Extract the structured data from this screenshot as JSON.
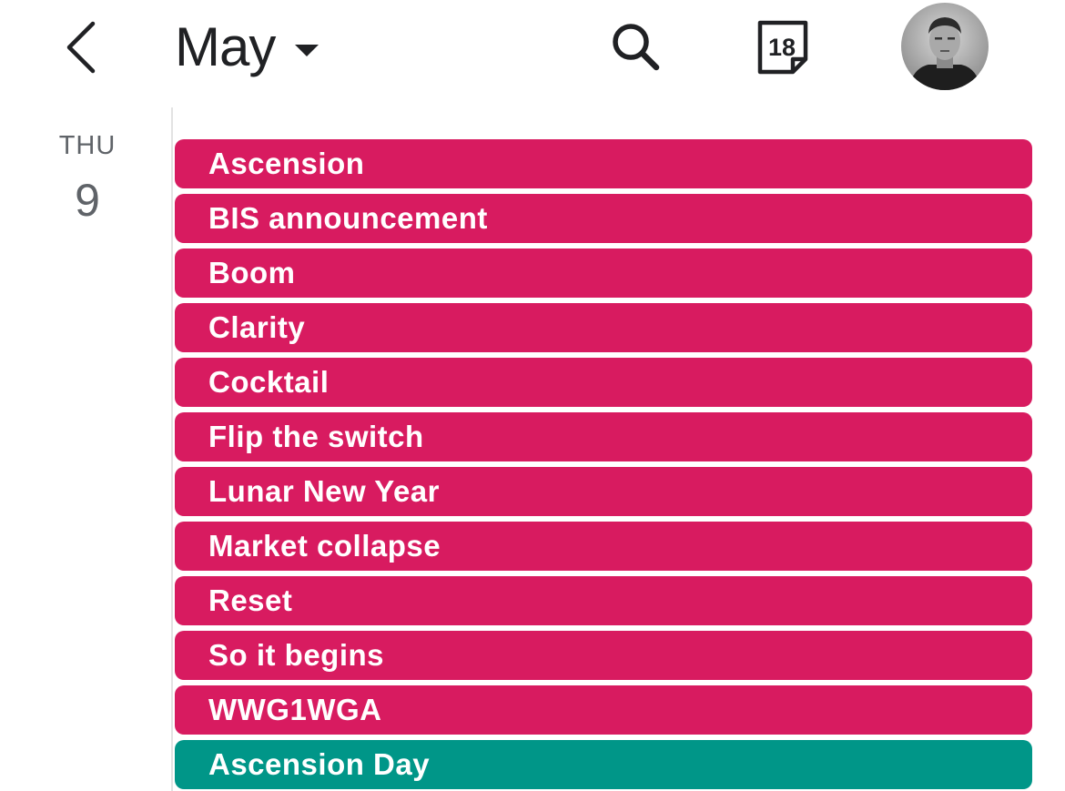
{
  "header": {
    "back_icon": "chevron-left-icon",
    "month": "May",
    "dropdown_icon": "caret-down-icon",
    "search_icon": "search-icon",
    "today_number": "18",
    "today_icon": "calendar-today-icon",
    "avatar_icon": "user-avatar"
  },
  "day": {
    "name": "THU",
    "number": "9"
  },
  "colors": {
    "event_magenta": "#D81B60",
    "event_teal": "#009688",
    "text_primary": "#202124",
    "text_secondary": "#5f6368"
  },
  "events": [
    {
      "title": "Ascension",
      "color": "#D81B60"
    },
    {
      "title": "BIS announcement",
      "color": "#D81B60"
    },
    {
      "title": "Boom",
      "color": "#D81B60"
    },
    {
      "title": "Clarity",
      "color": "#D81B60"
    },
    {
      "title": "Cocktail",
      "color": "#D81B60"
    },
    {
      "title": "Flip the switch",
      "color": "#D81B60"
    },
    {
      "title": "Lunar New Year",
      "color": "#D81B60"
    },
    {
      "title": "Market collapse",
      "color": "#D81B60"
    },
    {
      "title": "Reset",
      "color": "#D81B60"
    },
    {
      "title": "So it begins",
      "color": "#D81B60"
    },
    {
      "title": "WWG1WGA",
      "color": "#D81B60"
    },
    {
      "title": "Ascension Day",
      "color": "#009688"
    }
  ]
}
